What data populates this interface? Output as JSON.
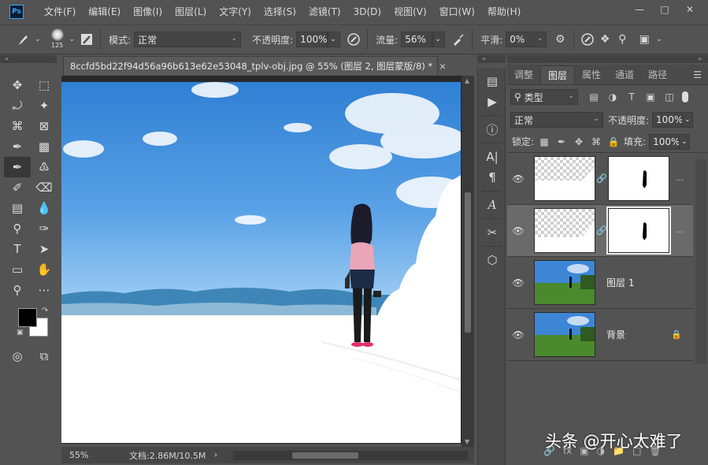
{
  "menubar": {
    "logo": "Ps",
    "items": [
      "文件(F)",
      "编辑(E)",
      "图像(I)",
      "图层(L)",
      "文字(Y)",
      "选择(S)",
      "滤镜(T)",
      "3D(D)",
      "视图(V)",
      "窗口(W)",
      "帮助(H)"
    ]
  },
  "options": {
    "brush_size": "125",
    "mode_label": "模式:",
    "mode_value": "正常",
    "opacity_label": "不透明度:",
    "opacity_value": "100%",
    "flow_label": "流量:",
    "flow_value": "56%",
    "smoothing_label": "平滑:",
    "smoothing_value": "0%"
  },
  "document": {
    "tab_title": "8ccfd5bd22f94d56a96b613e62e53048_tplv-obj.jpg @ 55% (图层 2, 图层蒙版/8) *",
    "tab_close": "×",
    "zoom": "55%",
    "doc_info": "文档:2.86M/10.5M"
  },
  "colors": {
    "foreground": "#000000",
    "background": "#ffffff",
    "accent": "#31a8ff"
  },
  "layers_panel": {
    "tabs": [
      "调整",
      "图层",
      "属性",
      "通道",
      "路径"
    ],
    "active_tab": "图层",
    "filter_value": "类型",
    "blend_value": "正常",
    "opacity_label": "不透明度:",
    "opacity_value": "100%",
    "lock_label": "锁定:",
    "fill_label": "填充:",
    "fill_value": "100%",
    "layers": [
      {
        "name": "",
        "has_mask": true,
        "selected": false
      },
      {
        "name": "",
        "has_mask": true,
        "selected": true
      },
      {
        "name": "图层 1",
        "has_mask": false,
        "selected": false
      },
      {
        "name": "背景",
        "has_mask": false,
        "selected": false,
        "locked": true
      }
    ]
  },
  "watermark": "头条 @开心太难了"
}
